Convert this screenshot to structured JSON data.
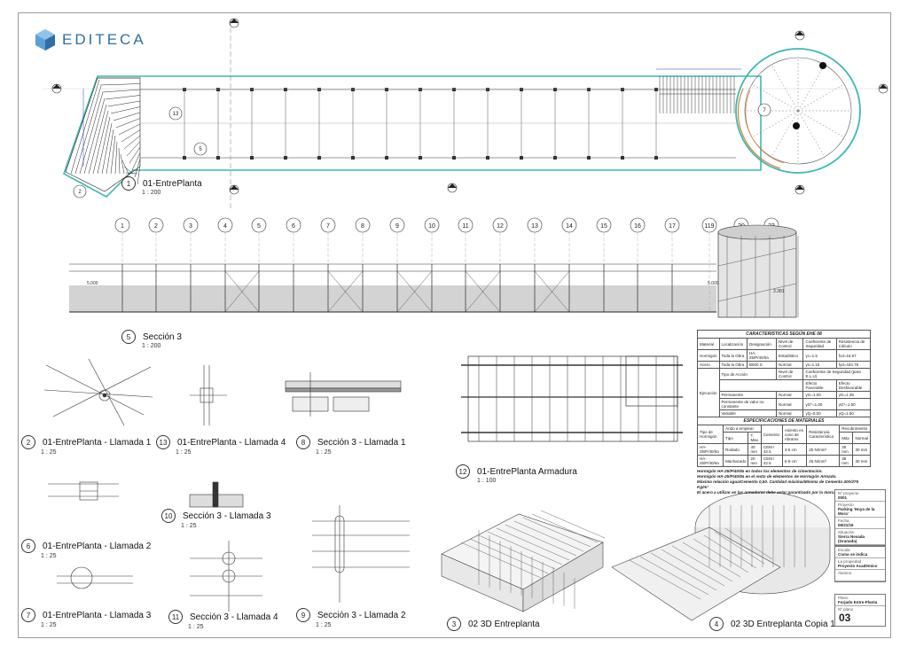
{
  "brand": {
    "name": "EDITECA"
  },
  "views": [
    {
      "id": "v1",
      "number": "1",
      "name": "01-EntrePlanta",
      "scale": "1 : 200"
    },
    {
      "id": "v5",
      "number": "5",
      "name": "Sección 3",
      "scale": "1 : 200"
    },
    {
      "id": "v2",
      "number": "2",
      "name": "01-EntrePlanta - Llamada 1",
      "scale": "1 : 25"
    },
    {
      "id": "v13",
      "number": "13",
      "name": "01-EntrePlanta - Llamada 4",
      "scale": "1 : 25"
    },
    {
      "id": "v8",
      "number": "8",
      "name": "Sección 3 - Llamada 1",
      "scale": "1 : 25"
    },
    {
      "id": "v12",
      "number": "12",
      "name": "01-EntrePlanta  Armadura",
      "scale": "1 : 100"
    },
    {
      "id": "v6",
      "number": "6",
      "name": "01-EntrePlanta - Llamada 2",
      "scale": "1 : 25"
    },
    {
      "id": "v10",
      "number": "10",
      "name": "Sección 3 - Llamada 3",
      "scale": "1 : 25"
    },
    {
      "id": "v7",
      "number": "7",
      "name": "01-EntrePlanta - Llamada 3",
      "scale": "1 : 25"
    },
    {
      "id": "v11",
      "number": "11",
      "name": "Sección 3 - Llamada 4",
      "scale": "1 : 25"
    },
    {
      "id": "v9",
      "number": "9",
      "name": "Sección 3 - Llamada 2",
      "scale": "1 : 25"
    },
    {
      "id": "v3",
      "number": "3",
      "name": "02 3D Entreplanta",
      "scale": ""
    },
    {
      "id": "v4",
      "number": "4",
      "name": "02 3D Entreplanta Copia 1",
      "scale": ""
    }
  ],
  "grid_labels": [
    "1",
    "2",
    "3",
    "4",
    "5",
    "6",
    "7",
    "8",
    "9",
    "10",
    "11",
    "12",
    "13",
    "14",
    "15",
    "16",
    "17",
    "119",
    "20",
    "23"
  ],
  "section_levels": [
    "5.000",
    "5.000",
    "3.381"
  ],
  "plan_callouts": [
    "13",
    "5",
    "2",
    "7"
  ],
  "spec_table_1": {
    "title": "CARACTERISTICAS SEGÚN EHE 08",
    "headers": [
      "Material",
      "Localización",
      "Designación",
      "Nivel de Control",
      "Coeficiente de Seguridad",
      "Resistencia de Cálculo"
    ],
    "rows": [
      [
        "Hormigón",
        "Toda la Obra",
        "HA-25/P/40/IIa",
        "Estadístico",
        "γc=1.5",
        "fcd=16.67"
      ],
      [
        "Acero",
        "Toda la Obra",
        "B500 S",
        "Normal",
        "γs=1.15",
        "fyd=434.78"
      ]
    ],
    "exec_label": "Ejecución",
    "exec_headers": [
      "Tipo de Acción",
      "Nivel de Control",
      "Coeficiente de Seguridad (para E.L.U)"
    ],
    "exec_sub": [
      "Efecto Favorable",
      "Efecto Desfavorable"
    ],
    "exec_rows": [
      [
        "Permanente",
        "Normal",
        "γG=1.00",
        "γG=1.35"
      ],
      [
        "Permanente de valor no constante",
        "Normal",
        "γG*=1.00",
        "γG*=1.50"
      ],
      [
        "Variable",
        "Normal",
        "γQ=0.00",
        "γQ=1.50"
      ]
    ]
  },
  "spec_table_2": {
    "title": "ESPECIFICACIONES DE MATERIALES",
    "headers": [
      "Tipo de Hormigón",
      "Árido a emplear",
      "Cemento",
      "Asiento en cono de Abrams",
      "Resistencia Característica",
      "Recubrimiento"
    ],
    "sub": [
      "Tipo",
      "T. Max",
      "Máx",
      "Normal"
    ],
    "rows": [
      [
        "HA-25/P/40/IIa",
        "Rodado",
        "40 mm",
        "CEM I 42.5",
        "3-5 cm",
        "25 N/mm²",
        "35 mm",
        "30 mm"
      ],
      [
        "HA-25/P/40/IIa",
        "Machacado",
        "20 mm",
        "CEM I 42.5",
        "6-9 cm",
        "25 N/mm²",
        "35 mm",
        "30 mm"
      ]
    ],
    "notes": [
      "Hormigón HA-25/P/40/IIa en todos los elementos de cimentación.",
      "Hormigón HA-25/P/40/IIa en el resto de elementos de Hormigón Armado.",
      "Máxima relación agua/Cemento 0,50. Cantidad máxima/Mínima de Cemento 400/275 Kg/m³",
      "El acero a utilizar en las armaduras debe estar garantizado por la marca AENOR"
    ]
  },
  "title_block": [
    {
      "label": "Nº proyecto",
      "value": "0001"
    },
    {
      "label": "Proyecto",
      "value": "Parking 'Hoya de la Mora'"
    },
    {
      "label": "Fecha",
      "value": "06/21/16"
    },
    {
      "label": "Situación",
      "value": "Sierra Nevada (Granada)"
    }
  ],
  "title_block_2": [
    {
      "label": "Escala",
      "value": "Como se indica"
    },
    {
      "label": "La propiedad",
      "value": "Proyecto Académico"
    },
    {
      "label": "Alumno",
      "value": ""
    }
  ],
  "plano": {
    "label": "Plano",
    "value": "Forjado Entre-Planta",
    "num_label": "Nº plano",
    "num": "03"
  },
  "colors": {
    "brand": "#2f6fa3",
    "plan_outline": "#3fb8b0",
    "arc": "#d9823b",
    "dim": "#1f3fd6"
  }
}
